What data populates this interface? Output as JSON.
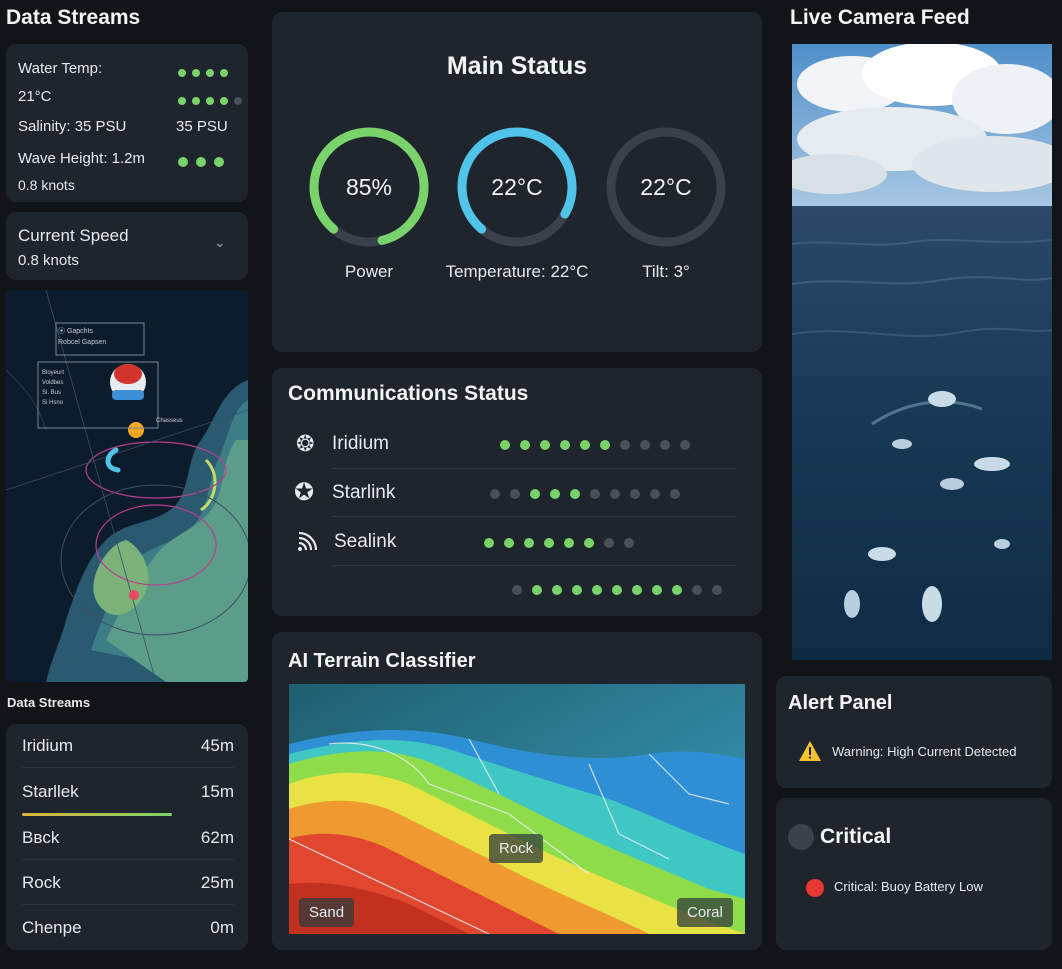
{
  "left": {
    "title": "Data Streams",
    "streams_card": {
      "water_temp_label": "Water Temp:",
      "water_temp_value": "21°C",
      "salinity_label": "Salinity: 35 PSU",
      "salinity_value": "35 PSU",
      "wave_label": "Wave Height: 1.2m",
      "speed_value": "0.8 knots",
      "dots_row1": [
        1,
        1,
        1,
        1
      ],
      "dots_row2": [
        1,
        1,
        1,
        1,
        0
      ],
      "dots_row3": [
        1,
        1,
        1
      ]
    },
    "current_speed": {
      "label": "Current Speed",
      "value": "0.8 knots"
    },
    "map_legend": {
      "top": [
        "⦿ Gapchts",
        "Robcel Gapsen"
      ],
      "side": [
        "Bloyeurt",
        "Voldbes",
        "Si. Bus",
        "Si Hsno"
      ],
      "label": "Chasseus"
    },
    "list_title": "Data Streams",
    "table": [
      {
        "name": "Iridium",
        "value": "45m"
      },
      {
        "name": "Starllek",
        "value": "15m"
      },
      {
        "name": "Bвck",
        "value": "62m"
      },
      {
        "name": "Rock",
        "value": "25m"
      },
      {
        "name": "Chenpe",
        "value": "0m"
      }
    ]
  },
  "main_status": {
    "title": "Main Status",
    "gauges": [
      {
        "value": "85%",
        "label": "Power",
        "fraction": 0.85,
        "color": "#7ad36a"
      },
      {
        "value": "22°C",
        "label": "Temperature: 22°C",
        "fraction": 0.72,
        "color": "#4fc3e8"
      },
      {
        "value": "22°C",
        "label": "Tilt: 3°",
        "fraction": 0.0,
        "color": "#9aa0a6"
      }
    ]
  },
  "comms": {
    "title": "Communications Status",
    "rows": [
      {
        "name": "Iridium",
        "icon": "globe-icon",
        "dots": [
          1,
          1,
          1,
          1,
          1,
          1,
          0,
          0,
          0,
          0
        ]
      },
      {
        "name": "Starlink",
        "icon": "satellite-icon",
        "dots": [
          0,
          0,
          1,
          1,
          1,
          0,
          0,
          0,
          0,
          0
        ]
      },
      {
        "name": "Sealink",
        "icon": "wifi-icon",
        "dots": [
          1,
          1,
          1,
          1,
          1,
          1,
          0,
          0
        ]
      }
    ],
    "extra_dots": [
      0,
      1,
      1,
      1,
      1,
      1,
      1,
      1,
      1,
      0,
      0
    ]
  },
  "terrain": {
    "title": "AI Terrain Classifier",
    "labels": {
      "rock": "Rock",
      "sand": "Sand",
      "coral": "Coral"
    }
  },
  "camera": {
    "title": "Live Camera Feed"
  },
  "alert": {
    "title": "Alert Panel",
    "warning": "Warning: High Current Detected",
    "warning_color": "#f4c430"
  },
  "critical": {
    "title": "Critical",
    "message": "Critical: Buoy Battery Low",
    "critical_color": "#e53935"
  }
}
